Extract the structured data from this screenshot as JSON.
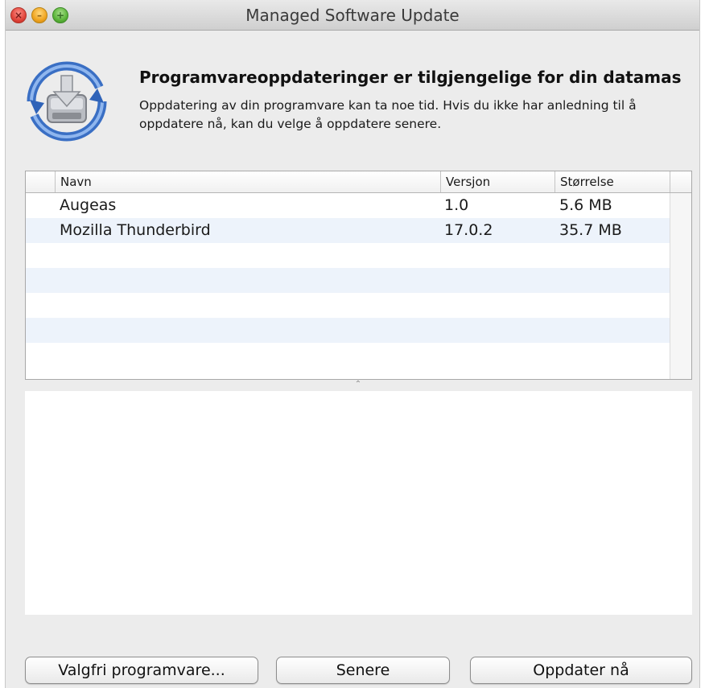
{
  "window": {
    "title": "Managed Software Update"
  },
  "header": {
    "headline": "Programvareoppdateringer er tilgjengelige for din datamas",
    "description": "Oppdatering av din programvare kan ta noe tid. Hvis du ikke har anledning til å oppdatere nå, kan du velge å oppdatere senere."
  },
  "table": {
    "columns": {
      "name": "Navn",
      "version": "Versjon",
      "size": "Størrelse"
    },
    "rows": [
      {
        "name": "Augeas",
        "version": "1.0",
        "size": "5.6 MB"
      },
      {
        "name": "Mozilla Thunderbird",
        "version": "17.0.2",
        "size": "35.7 MB"
      },
      {
        "name": "",
        "version": "",
        "size": ""
      },
      {
        "name": "",
        "version": "",
        "size": ""
      },
      {
        "name": "",
        "version": "",
        "size": ""
      },
      {
        "name": "",
        "version": "",
        "size": ""
      },
      {
        "name": "",
        "version": "",
        "size": ""
      }
    ]
  },
  "buttons": {
    "optional": "Valgfri programvare...",
    "later": "Senere",
    "update_now": "Oppdater nå"
  },
  "colors": {
    "row_alt": "#edf3fb",
    "window_bg": "#ececec"
  }
}
